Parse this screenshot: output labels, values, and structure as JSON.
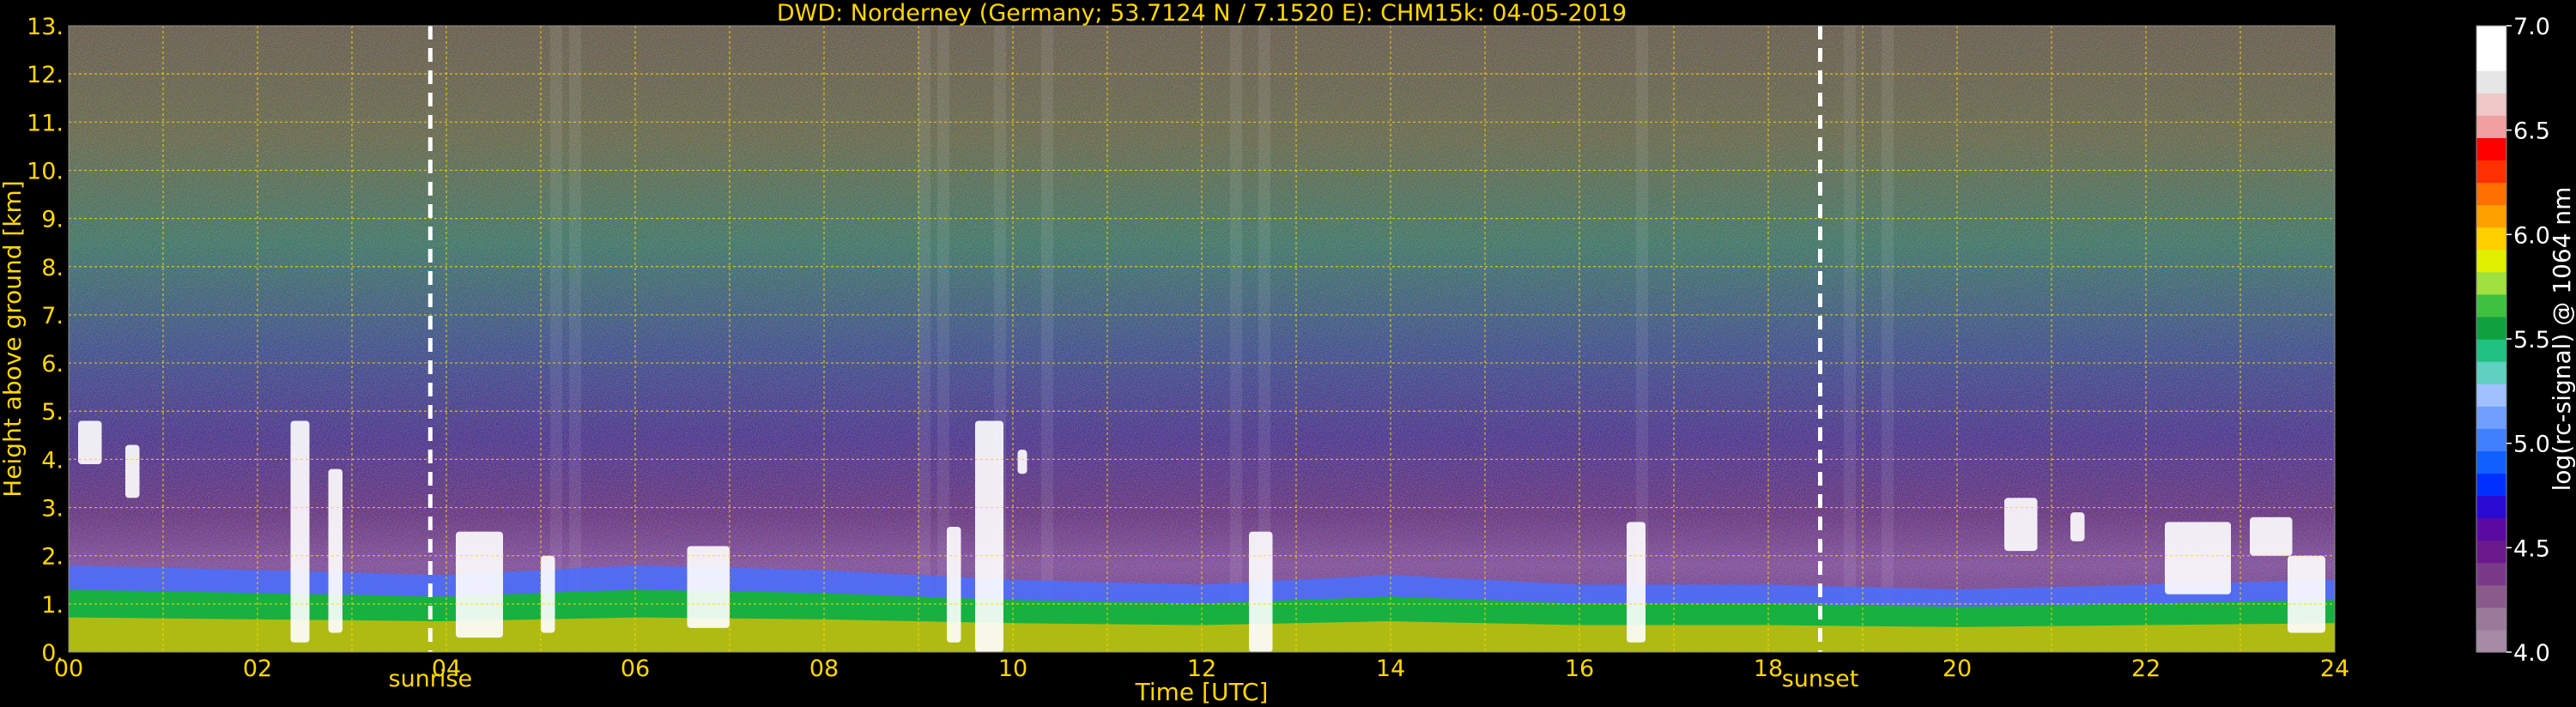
{
  "chart_data": {
    "type": "heatmap",
    "title": "DWD: Norderney (Germany; 53.7124 N / 7.1520 E):    CHM15k: 04-05-2019",
    "xlabel": "Time [UTC]",
    "ylabel": "Height above ground [km]",
    "colorbar_label": "log(rc-signal) @ 1064 nm",
    "xlim": [
      0,
      24
    ],
    "ylim": [
      0,
      13
    ],
    "x_ticks": [
      "00",
      "02",
      "04",
      "06",
      "08",
      "10",
      "12",
      "14",
      "16",
      "18",
      "20",
      "22",
      "24"
    ],
    "y_ticks": [
      "0.",
      "1.",
      "2.",
      "3.",
      "4.",
      "5.",
      "6.",
      "7.",
      "8.",
      "9.",
      "10.",
      "11.",
      "12.",
      "13."
    ],
    "colorbar_range": [
      4.0,
      7.0
    ],
    "colorbar_ticks": [
      "4.0",
      "4.5",
      "5.0",
      "5.5",
      "6.0",
      "6.5",
      "7.0"
    ],
    "grid": true,
    "markers": [
      {
        "label": "sunrise",
        "time": 3.83
      },
      {
        "label": "sunset",
        "time": 18.55
      }
    ],
    "boundary_layer_top_km": [
      [
        0,
        1.8
      ],
      [
        2,
        1.7
      ],
      [
        4,
        1.6
      ],
      [
        6,
        1.8
      ],
      [
        8,
        1.7
      ],
      [
        10,
        1.5
      ],
      [
        12,
        1.4
      ],
      [
        14,
        1.6
      ],
      [
        16,
        1.4
      ],
      [
        18,
        1.4
      ],
      [
        20,
        1.3
      ],
      [
        22,
        1.4
      ],
      [
        24,
        1.5
      ]
    ],
    "cloud_features": [
      {
        "t0": 0.1,
        "t1": 0.35,
        "h0": 3.9,
        "h1": 4.8
      },
      {
        "t0": 0.6,
        "t1": 0.75,
        "h0": 3.2,
        "h1": 4.3
      },
      {
        "t0": 2.35,
        "t1": 2.55,
        "h0": 0.2,
        "h1": 4.8
      },
      {
        "t0": 2.75,
        "t1": 2.9,
        "h0": 0.4,
        "h1": 3.8
      },
      {
        "t0": 4.1,
        "t1": 4.6,
        "h0": 0.3,
        "h1": 2.5
      },
      {
        "t0": 5.0,
        "t1": 5.15,
        "h0": 0.4,
        "h1": 2.0
      },
      {
        "t0": 6.55,
        "t1": 7.0,
        "h0": 0.5,
        "h1": 2.2
      },
      {
        "t0": 9.3,
        "t1": 9.45,
        "h0": 0.2,
        "h1": 2.6
      },
      {
        "t0": 9.6,
        "t1": 9.9,
        "h0": 0.0,
        "h1": 4.8
      },
      {
        "t0": 10.05,
        "t1": 10.15,
        "h0": 3.7,
        "h1": 4.2
      },
      {
        "t0": 12.5,
        "t1": 12.75,
        "h0": 0.0,
        "h1": 2.5
      },
      {
        "t0": 16.5,
        "t1": 16.7,
        "h0": 0.2,
        "h1": 2.7
      },
      {
        "t0": 20.5,
        "t1": 20.85,
        "h0": 2.1,
        "h1": 3.2
      },
      {
        "t0": 21.2,
        "t1": 21.35,
        "h0": 2.3,
        "h1": 2.9
      },
      {
        "t0": 22.2,
        "t1": 22.9,
        "h0": 1.2,
        "h1": 2.7
      },
      {
        "t0": 23.1,
        "t1": 23.55,
        "h0": 2.0,
        "h1": 2.8
      },
      {
        "t0": 23.5,
        "t1": 23.9,
        "h0": 0.4,
        "h1": 2.0
      }
    ]
  },
  "colorbar_colors": [
    "#a68aa6",
    "#9a7a9a",
    "#8a5a8a",
    "#7a3a8a",
    "#6a1a8a",
    "#5a0aa0",
    "#2a0ad0",
    "#0030ff",
    "#1060ff",
    "#4080ff",
    "#70a0ff",
    "#a0c0ff",
    "#60d0c0",
    "#20c080",
    "#10a040",
    "#40c040",
    "#a0e040",
    "#e0f000",
    "#ffd000",
    "#ffa000",
    "#ff7000",
    "#ff3000",
    "#ff0000",
    "#f0a0a0",
    "#f0c8c8",
    "#e6e6e6",
    "#ffffff",
    "#ffffff"
  ]
}
